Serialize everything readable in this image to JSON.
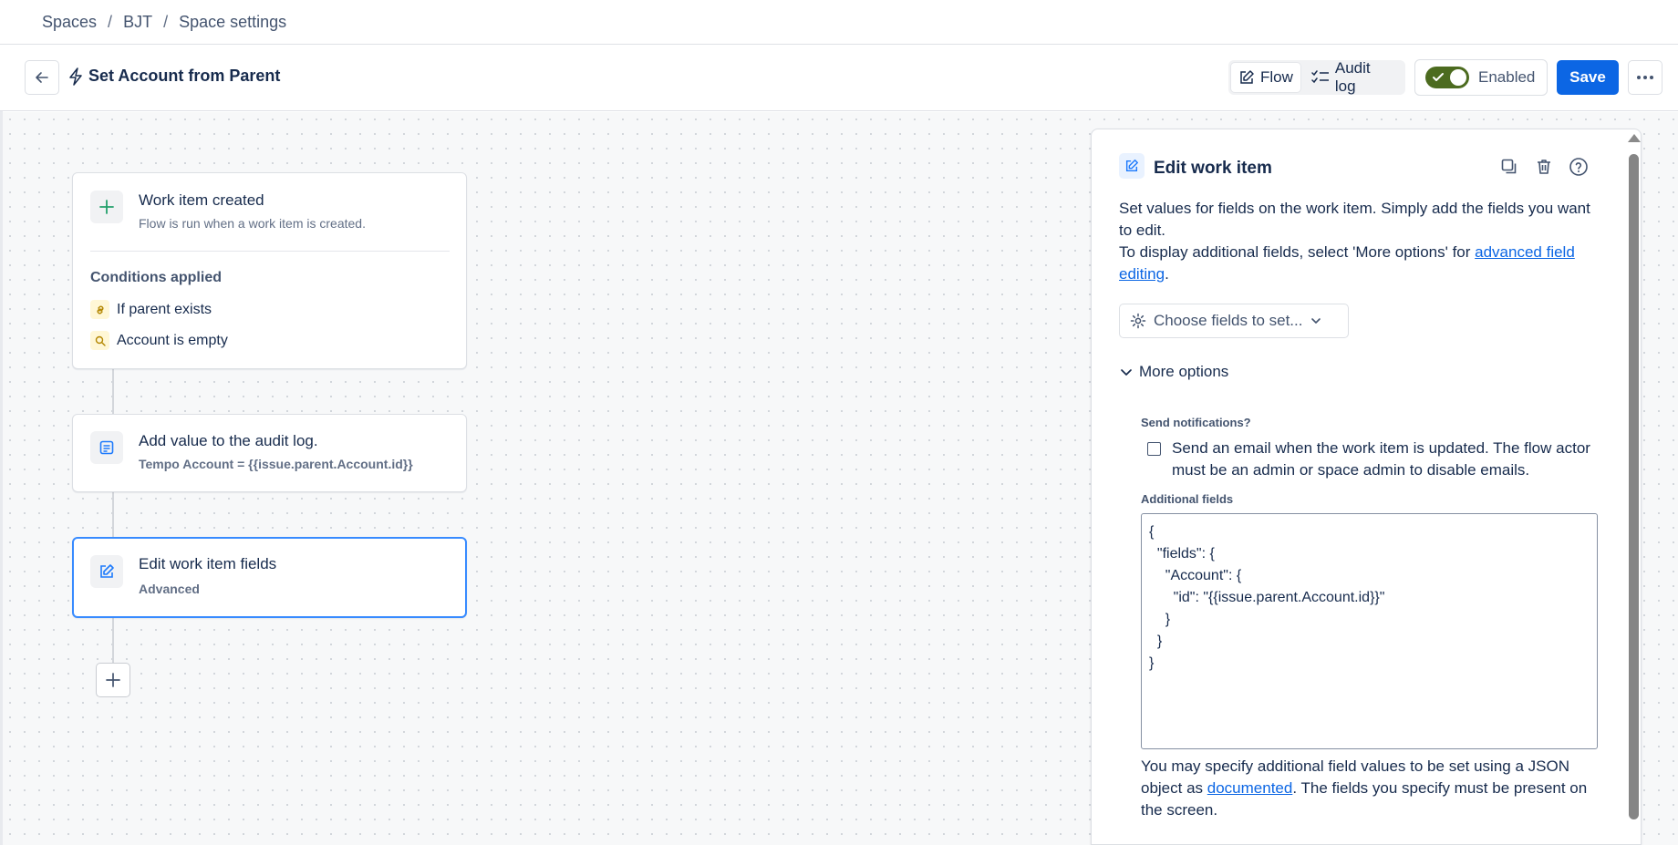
{
  "breadcrumb": [
    "Spaces",
    "BJT",
    "Space settings"
  ],
  "header": {
    "rule_title": "Set Account from Parent",
    "tabs": [
      {
        "label": "Flow",
        "active": true
      },
      {
        "label": "Audit log",
        "active": false
      }
    ],
    "enabled_label": "Enabled",
    "enabled": true,
    "save_label": "Save"
  },
  "flow": {
    "trigger": {
      "title": "Work item created",
      "subtitle": "Flow is run when a work item is created.",
      "conditions_heading": "Conditions applied",
      "conditions": [
        "If parent exists",
        "Account is empty"
      ]
    },
    "steps": [
      {
        "title": "Add value to the audit log.",
        "subtitle": "Tempo Account = {{issue.parent.Account.id}}"
      },
      {
        "title": "Edit work item fields",
        "subtitle": "Advanced"
      }
    ]
  },
  "panel": {
    "title": "Edit work item",
    "description_1": "Set values for fields on the work item. Simply add the fields you want to edit.",
    "description_2_prefix": "To display additional fields, select 'More options' for ",
    "description_2_link": "advanced field editing",
    "description_2_suffix": ".",
    "choose_fields_label": "Choose fields to set...",
    "more_options_label": "More options",
    "send_notifications_label": "Send notifications?",
    "send_email_text": "Send an email when the work item is updated. The flow actor must be an admin or space admin to disable emails.",
    "send_email_checked": false,
    "additional_fields_label": "Additional fields",
    "additional_fields_json": "{\n  \"fields\": {\n    \"Account\": {\n      \"id\": \"{{issue.parent.Account.id}}\"\n    }\n  }\n}",
    "help_prefix": "You may specify additional field values to be set using a JSON object as ",
    "help_link": "documented",
    "help_suffix": ". The fields you specify must be present on the screen."
  },
  "colors": {
    "primary": "#0c66e4",
    "toggle_on": "#4c6b1f",
    "selected_border": "#388bff"
  }
}
